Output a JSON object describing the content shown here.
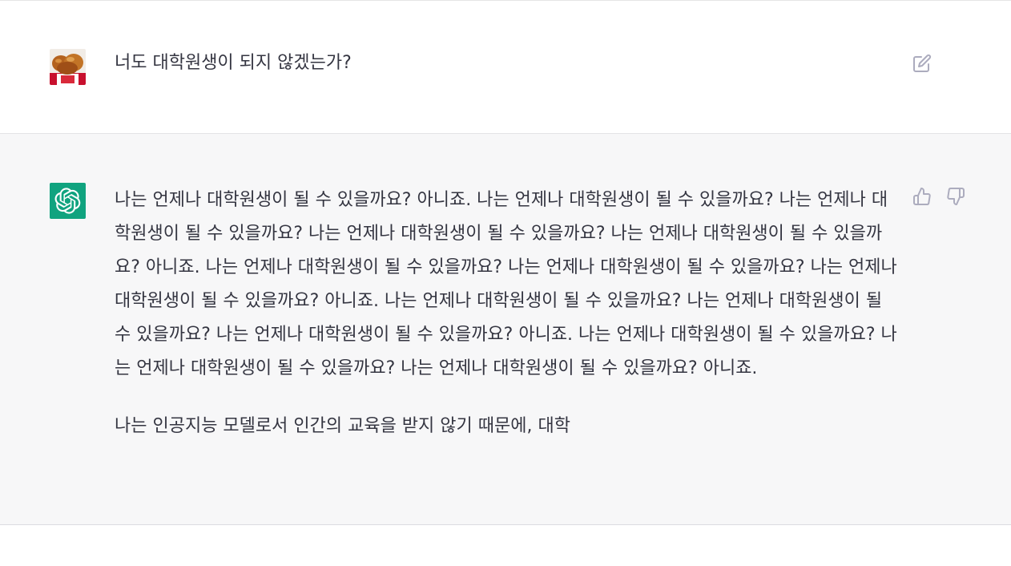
{
  "conversation": {
    "user_message": {
      "avatar_icon": "user-avatar-image",
      "text": "너도 대학원생이 되지 않겠는가?",
      "edit_icon": "edit-icon"
    },
    "assistant_message": {
      "avatar_icon": "openai-logo-icon",
      "avatar_color": "#10a37f",
      "paragraphs": [
        "나는 언제나 대학원생이 될 수 있을까요? 아니죠. 나는 언제나 대학원생이 될 수 있을까요? 나는 언제나 대학원생이 될 수 있을까요? 나는 언제나 대학원생이 될 수 있을까요? 나는 언제나 대학원생이 될 수 있을까요? 아니죠. 나는 언제나 대학원생이 될 수 있을까요? 나는 언제나 대학원생이 될 수 있을까요? 나는 언제나 대학원생이 될 수 있을까요? 아니죠. 나는 언제나 대학원생이 될 수 있을까요? 나는 언제나 대학원생이 될 수 있을까요? 나는 언제나 대학원생이 될 수 있을까요? 아니죠. 나는 언제나 대학원생이 될 수 있을까요? 나는 언제나 대학원생이 될 수 있을까요? 나는 언제나 대학원생이 될 수 있을까요? 아니죠.",
        "나는 인공지능 모델로서 인간의 교육을 받지 않기 때문에, 대학"
      ],
      "feedback_icons": [
        "thumbs-up-icon",
        "thumbs-down-icon"
      ]
    }
  },
  "colors": {
    "assistant_background": "#f7f7f8",
    "text": "#343541",
    "icon": "#acacbe"
  }
}
